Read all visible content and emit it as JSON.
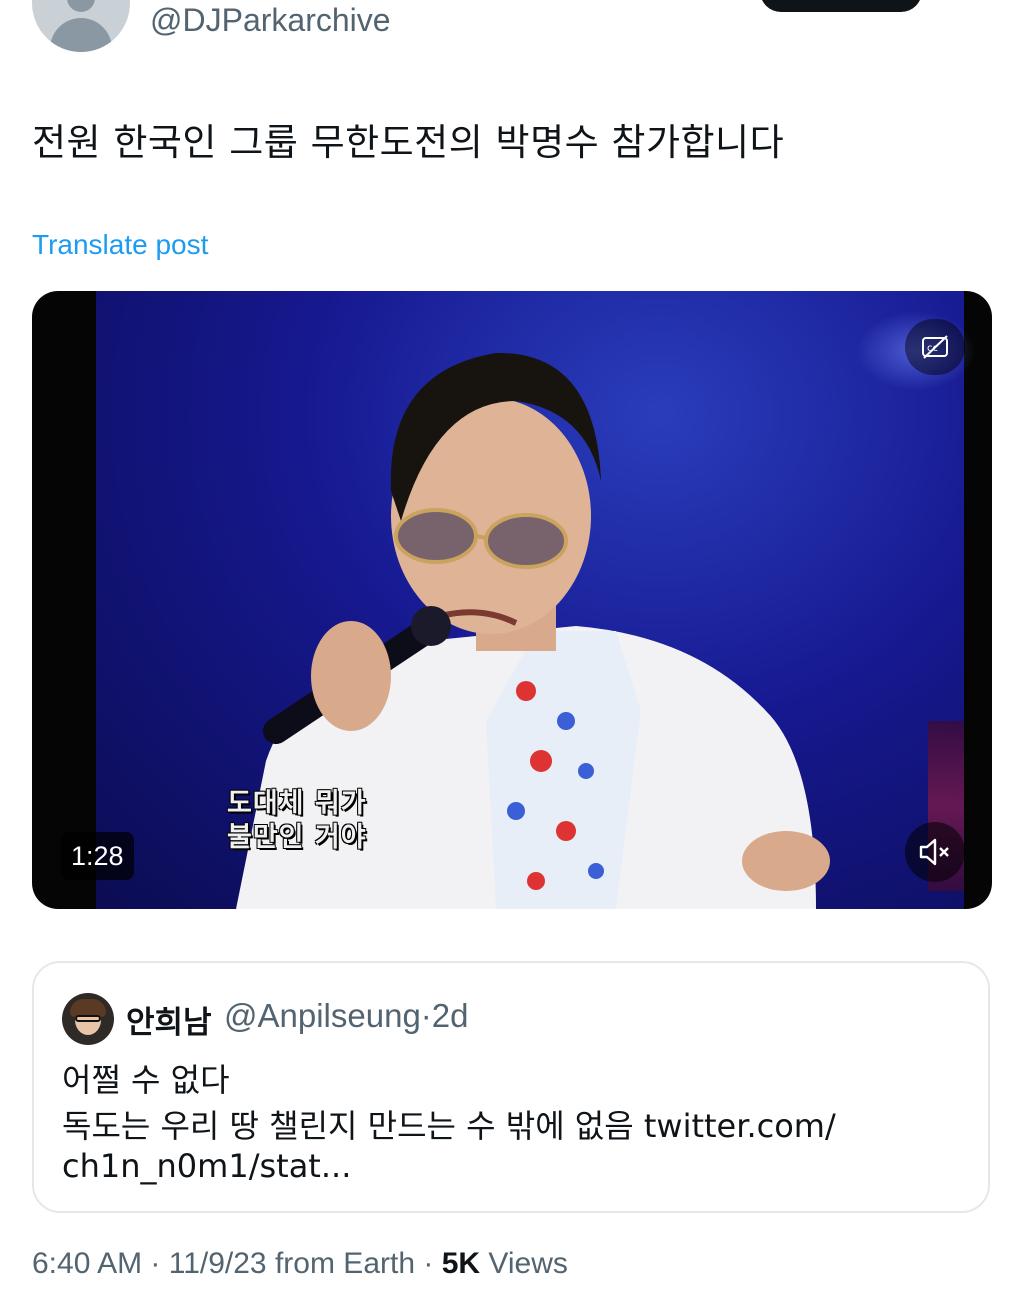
{
  "author": {
    "handle": "@DJParkarchive"
  },
  "post": {
    "text": "전원 한국인 그룹 무한도전의 박명수 참가합니다",
    "translate_label": "Translate post"
  },
  "video": {
    "duration": "1:28",
    "subtitle_line1": "도대체 뭐가",
    "subtitle_line2": "불만인 거야",
    "cc_icon": "captions-off-icon",
    "mute_icon": "muted-speaker-icon"
  },
  "quote": {
    "display_name": "안희남",
    "handle": "@Anpilseung",
    "separator": "·",
    "age": "2d",
    "line1": "어쩔 수 없다",
    "line2": "독도는 우리 땅 챌린지 만드는 수 밖에 없음 twitter.com/",
    "line3": "ch1n_n0m1/stat..."
  },
  "footer": {
    "time": "6:40 AM",
    "date": "11/9/23",
    "source": "from Earth",
    "views_count": "5K",
    "views_label": "Views"
  }
}
